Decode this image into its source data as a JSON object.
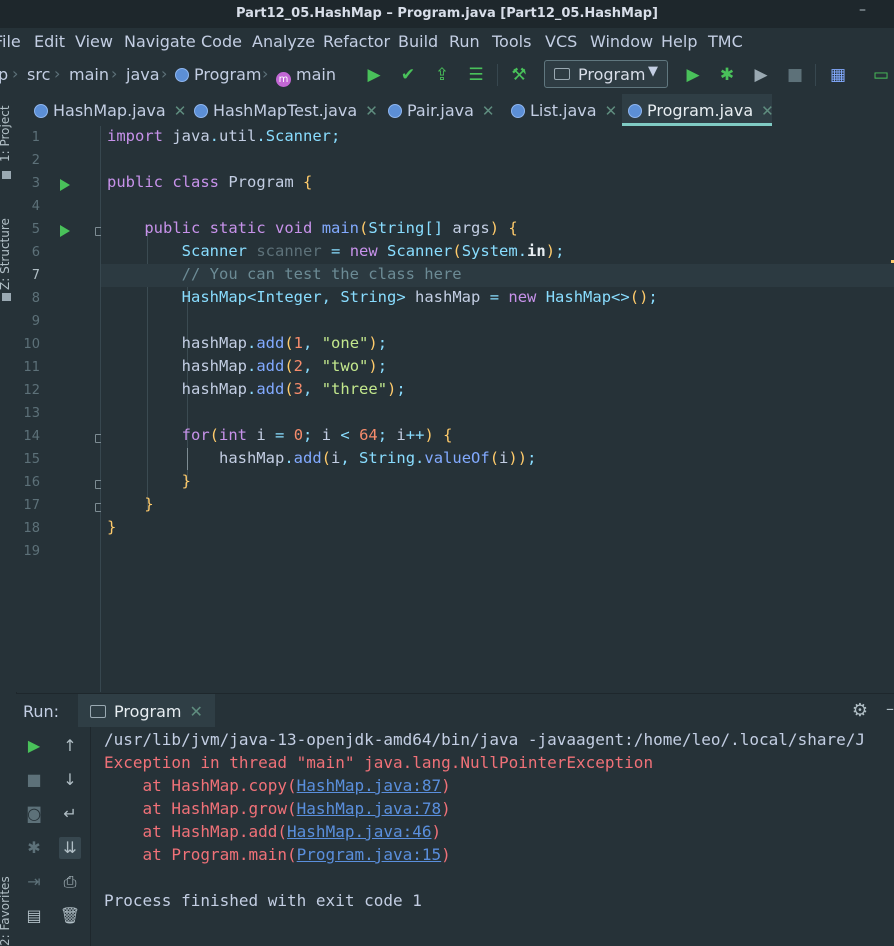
{
  "window": {
    "title": "Part12_05.HashMap – Program.java [Part12_05.HashMap]"
  },
  "menu": [
    "File",
    "Edit",
    "View",
    "Navigate",
    "Code",
    "Analyze",
    "Refactor",
    "Build",
    "Run",
    "Tools",
    "VCS",
    "Window",
    "Help",
    "TMC"
  ],
  "breadcrumb": {
    "root": "p",
    "items": [
      "src",
      "main",
      "java",
      "Program",
      "main"
    ]
  },
  "run_config": {
    "label": "Program"
  },
  "tool_windows": {
    "project": "1: Project",
    "structure": "Z: Structure",
    "favorites": "2: Favorites"
  },
  "tabs": [
    {
      "label": "HashMap.java",
      "active": false
    },
    {
      "label": "HashMapTest.java",
      "active": false
    },
    {
      "label": "Pair.java",
      "active": false
    },
    {
      "label": "List.java",
      "active": false
    },
    {
      "label": "Program.java",
      "active": true
    }
  ],
  "editor": {
    "current_line": 7,
    "line_numbers": [
      "1",
      "2",
      "3",
      "4",
      "5",
      "6",
      "7",
      "8",
      "9",
      "10",
      "11",
      "12",
      "13",
      "14",
      "15",
      "16",
      "17",
      "18",
      "19"
    ],
    "lines": [
      "import java.util.Scanner;",
      "",
      "public class Program {",
      "",
      "    public static void main(String[] args) {",
      "        Scanner scanner = new Scanner(System.in);",
      "        // You can test the class here",
      "        HashMap<Integer, String> hashMap = new HashMap<>();",
      "",
      "        hashMap.add(1, \"one\");",
      "        hashMap.add(2, \"two\");",
      "        hashMap.add(3, \"three\");",
      "",
      "        for(int i = 0; i < 64; i++) {",
      "            hashMap.add(i, String.valueOf(i));",
      "        }",
      "    }",
      "}",
      ""
    ]
  },
  "run_panel": {
    "label": "Run:",
    "tab": "Program",
    "console": {
      "command": "/usr/lib/jvm/java-13-openjdk-amd64/bin/java -javaagent:/home/leo/.local/share/J",
      "exception": "Exception in thread \"main\" java.lang.NullPointerException",
      "stack": [
        {
          "prefix": "    at HashMap.copy(",
          "link": "HashMap.java:87",
          "suffix": ")"
        },
        {
          "prefix": "    at HashMap.grow(",
          "link": "HashMap.java:78",
          "suffix": ")"
        },
        {
          "prefix": "    at HashMap.add(",
          "link": "HashMap.java:46",
          "suffix": ")"
        },
        {
          "prefix": "    at Program.main(",
          "link": "Program.java:15",
          "suffix": ")"
        }
      ],
      "exit": "Process finished with exit code 1"
    }
  },
  "colors": {
    "background": "#263238",
    "accent": "#80cbc4",
    "keyword": "#c792ea",
    "string": "#c3e88d",
    "number": "#f78c6c",
    "error": "#f07178",
    "run_green": "#49c15a"
  }
}
